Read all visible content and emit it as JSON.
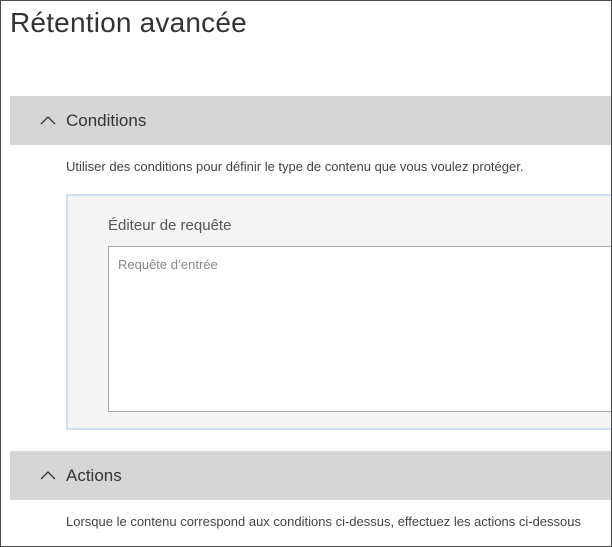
{
  "page": {
    "title": "Rétention avancée"
  },
  "conditions": {
    "header_label": "Conditions",
    "expanded": true,
    "description": "Utiliser des conditions pour définir le type de contenu que vous voulez protéger.",
    "editor": {
      "label": "Éditeur de requête",
      "input_value": "",
      "input_placeholder": "Requête d’entrée"
    }
  },
  "actions": {
    "header_label": "Actions",
    "expanded": true,
    "description": "Lorsque le contenu correspond aux conditions ci-dessus, effectuez les actions ci-dessous"
  },
  "icons": {
    "collapse": "chevron-up-icon"
  },
  "colors": {
    "section_header_bg": "#d6d6d6",
    "editor_panel_bg": "#f4f4f4",
    "editor_panel_border": "#cfe0f0",
    "text": "#333333"
  }
}
